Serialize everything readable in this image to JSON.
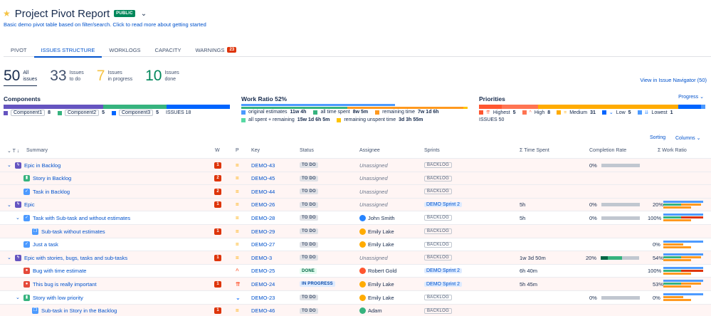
{
  "header": {
    "title": "Project Pivot Report",
    "badge": "PUBLIC",
    "subtitle": "Basic demo pivot table based on filter/search. Click to read more about getting started"
  },
  "tabs": [
    {
      "label": "PIVOT"
    },
    {
      "label": "ISSUES STRUCTURE",
      "active": true
    },
    {
      "label": "WORKLOGS"
    },
    {
      "label": "CAPACITY"
    },
    {
      "label": "WARNINGS",
      "count": "23"
    }
  ],
  "stats": {
    "all": {
      "num": "50",
      "l1": "All",
      "l2": "issues"
    },
    "todo": {
      "num": "33",
      "l1": "Issues",
      "l2": "to do"
    },
    "progress": {
      "num": "7",
      "l1": "Issues",
      "l2": "in progress"
    },
    "done": {
      "num": "10",
      "l1": "Issues",
      "l2": "done"
    }
  },
  "navigator_link": "View in Issue Navigator (50)",
  "components": {
    "title": "Components",
    "items": [
      {
        "name": "Component1",
        "count": "8",
        "color": "#6554c0"
      },
      {
        "name": "Component2",
        "count": "5",
        "color": "#36b37e"
      },
      {
        "name": "Component3",
        "count": "5",
        "color": "#0065ff"
      }
    ],
    "issues": "ISSUES 18"
  },
  "work_ratio": {
    "title": "Work Ratio",
    "pct": "52%",
    "legend": [
      {
        "label": "original estimates",
        "value": "11w 4h",
        "color": "#4c9aff"
      },
      {
        "label": "all time spent",
        "value": "8w 5m",
        "color": "#36b37e"
      },
      {
        "label": "remaining time",
        "value": "7w 1d 6h",
        "color": "#ff991f"
      },
      {
        "label": "all spent + remaining",
        "value": "15w 1d 6h 5m",
        "color": "#57d9a3"
      },
      {
        "label": "remaining unspent time",
        "value": "3d 3h 55m",
        "color": "#ffc400"
      }
    ]
  },
  "priorities": {
    "title": "Priorities",
    "items": [
      {
        "label": "Highest",
        "count": "5",
        "color": "#ff5630",
        "glyph": "⇈"
      },
      {
        "label": "High",
        "count": "8",
        "color": "#ff7452",
        "glyph": "^"
      },
      {
        "label": "Medium",
        "count": "31",
        "color": "#ffab00",
        "glyph": "="
      },
      {
        "label": "Low",
        "count": "5",
        "color": "#0065ff",
        "glyph": "⌄"
      },
      {
        "label": "Lowest",
        "count": "1",
        "color": "#4c9aff",
        "glyph": "⇊"
      }
    ],
    "issues": "ISSUES 50"
  },
  "controls": {
    "progress": "Progress",
    "sorting": "Sorting",
    "columns": "Columns"
  },
  "columns": {
    "summary": "Summary",
    "w": "W",
    "p": "P",
    "key": "Key",
    "status": "Status",
    "assignee": "Assignee",
    "sprints": "Sprints",
    "time": "Σ Time Spent",
    "completion": "Completion Rate",
    "ratio": "Σ Work Ratio"
  },
  "rows": [
    {
      "level": 0,
      "toggle": "⌄",
      "type": "epic",
      "summary": "Epic in Backlog",
      "w": "1",
      "key": "DEMO-43",
      "status": "TO DO",
      "st": "todo",
      "assignee": "Unassigned",
      "sprint": "BACKLOG",
      "time": "",
      "cr": "0%",
      "wr": "",
      "pink": true,
      "prio": "="
    },
    {
      "level": 1,
      "toggle": "",
      "type": "story",
      "summary": "Story in Backlog",
      "w": "2",
      "key": "DEMO-45",
      "status": "TO DO",
      "st": "todo",
      "assignee": "Unassigned",
      "sprint": "BACKLOG",
      "time": "",
      "cr": "",
      "wr": "",
      "pink": true,
      "prio": "="
    },
    {
      "level": 1,
      "toggle": "",
      "type": "task",
      "summary": "Task in Backlog",
      "w": "2",
      "key": "DEMO-44",
      "status": "TO DO",
      "st": "todo",
      "assignee": "Unassigned",
      "sprint": "BACKLOG",
      "time": "",
      "cr": "",
      "wr": "",
      "pink": true,
      "prio": "="
    },
    {
      "level": 0,
      "toggle": "⌄",
      "type": "epic",
      "summary": "Epic",
      "w": "1",
      "key": "DEMO-26",
      "status": "TO DO",
      "st": "todo",
      "assignee": "Unassigned",
      "sprint": "DEMO Sprint 2",
      "time": "5h",
      "cr": "0%",
      "wr": "20%",
      "pink": true,
      "prio": "="
    },
    {
      "level": 1,
      "toggle": "⌄",
      "type": "task",
      "summary": "Task with Sub-task and without estimates",
      "w": "",
      "key": "DEMO-28",
      "status": "TO DO",
      "st": "todo",
      "assignee": "John Smith",
      "sprint": "BACKLOG",
      "time": "5h",
      "cr": "0%",
      "wr": "100%",
      "pink": false,
      "prio": "=",
      "avatar": "#2684ff"
    },
    {
      "level": 2,
      "toggle": "",
      "type": "subtask",
      "summary": "Sub-task without estimates",
      "w": "1",
      "key": "DEMO-29",
      "status": "TO DO",
      "st": "todo",
      "assignee": "Emily Lake",
      "sprint": "BACKLOG",
      "time": "",
      "cr": "",
      "wr": "",
      "pink": true,
      "prio": "=",
      "avatar": "#ffab00"
    },
    {
      "level": 1,
      "toggle": "",
      "type": "task",
      "summary": "Just a task",
      "w": "",
      "key": "DEMO-27",
      "status": "TO DO",
      "st": "todo",
      "assignee": "Emily Lake",
      "sprint": "BACKLOG",
      "time": "",
      "cr": "",
      "wr": "0%",
      "pink": false,
      "prio": "=",
      "avatar": "#ffab00"
    },
    {
      "level": 0,
      "toggle": "⌄",
      "type": "epic",
      "summary": "Epic with stories, bugs, tasks and sub-tasks",
      "w": "1",
      "key": "DEMO-3",
      "status": "TO DO",
      "st": "todo",
      "assignee": "Unassigned",
      "sprint": "BACKLOG",
      "time": "1w 3d 50m",
      "cr": "20%",
      "wr": "54%",
      "pink": true,
      "prio": "="
    },
    {
      "level": 1,
      "toggle": "",
      "type": "bug",
      "summary": "Bug with time estimate",
      "w": "",
      "key": "DEMO-25",
      "status": "DONE",
      "st": "done",
      "assignee": "Robert Gold",
      "sprint": "DEMO Sprint 2",
      "time": "6h 40m",
      "cr": "",
      "wr": "100%",
      "pink": false,
      "prio": "^",
      "prioColor": "#ff7452",
      "avatar": "#ff5630"
    },
    {
      "level": 1,
      "toggle": "",
      "type": "bug",
      "summary": "This bug is really important",
      "w": "1",
      "key": "DEMO-24",
      "status": "IN PROGRESS",
      "st": "prog",
      "assignee": "Emily Lake",
      "sprint": "DEMO Sprint 2",
      "time": "5h 45m",
      "cr": "",
      "wr": "53%",
      "pink": true,
      "prio": "⇈",
      "prioColor": "#ff5630",
      "avatar": "#ffab00"
    },
    {
      "level": 1,
      "toggle": "⌄",
      "type": "story",
      "summary": "Story with low priority",
      "w": "",
      "key": "DEMO-23",
      "status": "TO DO",
      "st": "todo",
      "assignee": "Emily Lake",
      "sprint": "BACKLOG",
      "time": "",
      "cr": "0%",
      "wr": "0%",
      "pink": false,
      "prio": "⌄",
      "prioColor": "#0065ff",
      "avatar": "#ffab00"
    },
    {
      "level": 2,
      "toggle": "",
      "type": "subtask",
      "summary": "Sub-task in Story in the Backlog",
      "w": "1",
      "key": "DEMO-46",
      "status": "TO DO",
      "st": "todo",
      "assignee": "Adam",
      "sprint": "BACKLOG",
      "time": "",
      "cr": "",
      "wr": "",
      "pink": true,
      "prio": "=",
      "avatar": "#36b37e"
    }
  ]
}
